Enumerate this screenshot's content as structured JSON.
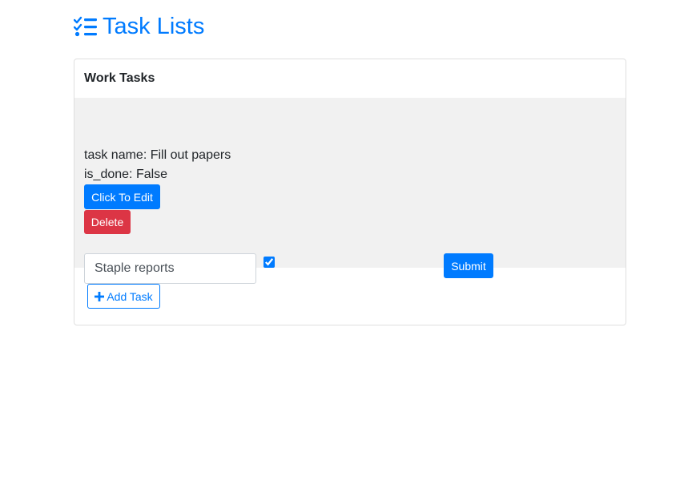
{
  "header": {
    "title": "Task Lists",
    "icon": "tasks-list-icon"
  },
  "card": {
    "title": "Work Tasks",
    "task": {
      "name_line": "task name: Fill out papers",
      "done_line": "is_done: False"
    },
    "edit_button_label": "Click To Edit",
    "delete_button_label": "Delete",
    "edit_form": {
      "task_input_value": "Staple reports",
      "is_done_checked": true,
      "submit_label": "Submit"
    },
    "add_task_label": "Add Task"
  },
  "colors": {
    "primary": "#007bff",
    "danger": "#dc3545",
    "body_bg": "#f1f1f1"
  }
}
